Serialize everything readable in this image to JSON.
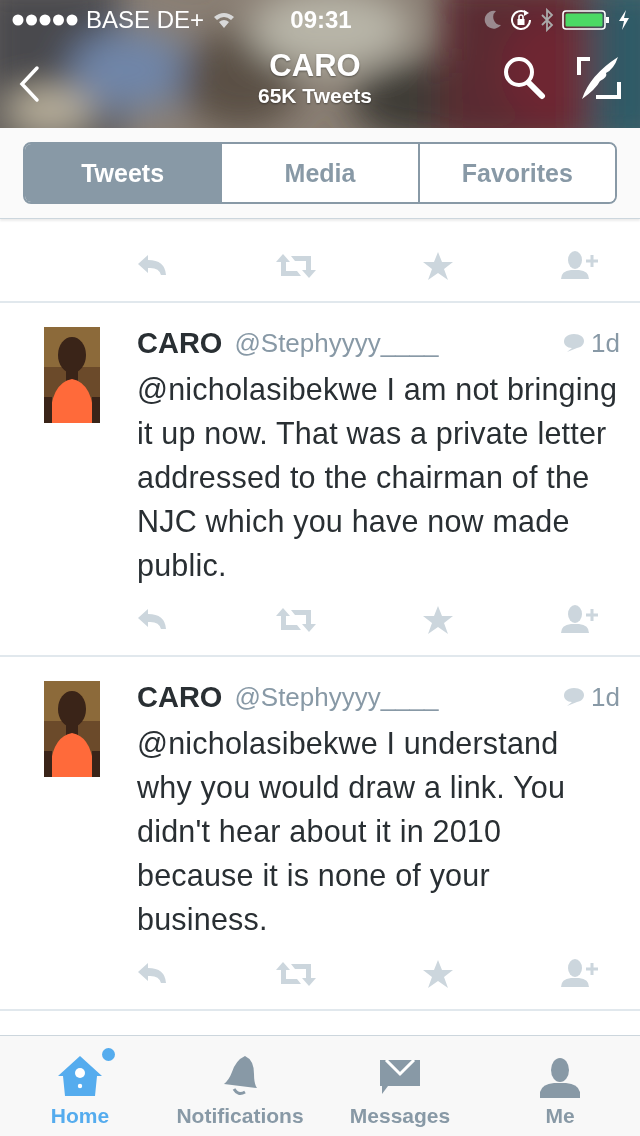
{
  "status_bar": {
    "carrier": "BASE DE+",
    "time": "09:31"
  },
  "header": {
    "title": "CARO",
    "subtitle": "65K Tweets"
  },
  "tabs": [
    {
      "label": "Tweets",
      "selected": true
    },
    {
      "label": "Media",
      "selected": false
    },
    {
      "label": "Favorites",
      "selected": false
    }
  ],
  "tweets": [
    {
      "name": "CARO",
      "handle": "@Stephyyyy____",
      "time": "1d",
      "text": "@nicholasibekwe I am not bringing it up now. That was a private letter addressed to the chairman of the NJC which you have now made public."
    },
    {
      "name": "CARO",
      "handle": "@Stephyyyy____",
      "time": "1d",
      "text": "@nicholasibekwe I understand why you would draw a link. You didn't hear about it in 2010 because it is none of your business."
    }
  ],
  "tab_bar": [
    {
      "label": "Home",
      "selected": true,
      "badge": true
    },
    {
      "label": "Notifications",
      "selected": false,
      "badge": false
    },
    {
      "label": "Messages",
      "selected": false,
      "badge": false
    },
    {
      "label": "Me",
      "selected": false,
      "badge": false
    }
  ]
}
